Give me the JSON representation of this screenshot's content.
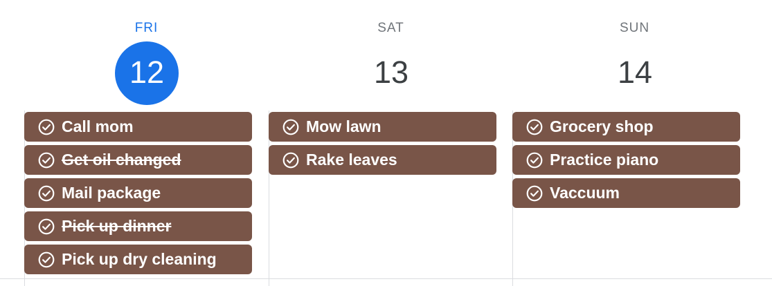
{
  "days": [
    {
      "weekday": "FRI",
      "date": "12",
      "is_today": true,
      "tasks": [
        {
          "label": "Call mom",
          "completed": false
        },
        {
          "label": "Get oil changed",
          "completed": true
        },
        {
          "label": "Mail package",
          "completed": false
        },
        {
          "label": "Pick up dinner",
          "completed": true
        },
        {
          "label": "Pick up dry cleaning",
          "completed": false
        }
      ]
    },
    {
      "weekday": "SAT",
      "date": "13",
      "is_today": false,
      "tasks": [
        {
          "label": "Mow lawn",
          "completed": false
        },
        {
          "label": "Rake leaves",
          "completed": false
        }
      ]
    },
    {
      "weekday": "SUN",
      "date": "14",
      "is_today": false,
      "tasks": [
        {
          "label": "Grocery shop",
          "completed": false
        },
        {
          "label": "Practice piano",
          "completed": false
        },
        {
          "label": "Vaccuum",
          "completed": false
        }
      ]
    }
  ],
  "colors": {
    "task_chip": "#795548",
    "today_accent": "#1a73e8",
    "weekday_text": "#70757a",
    "date_text": "#3c4043",
    "divider": "#dadce0"
  },
  "icons": {
    "task": "check-circle-icon"
  }
}
